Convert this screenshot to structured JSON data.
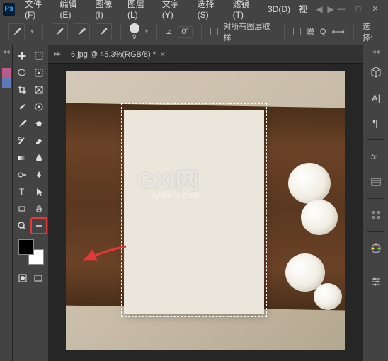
{
  "app": {
    "logo": "Ps"
  },
  "menu": {
    "file": "文件(F)",
    "edit": "编辑(E)",
    "image": "图像(I)",
    "layer": "图层(L)",
    "type": "文字(Y)",
    "select": "选择(S)",
    "filter": "滤镜(T)",
    "threeD": "3D(D)",
    "view": "视"
  },
  "options": {
    "brush_size": "9",
    "angle_icon": "⊿",
    "angle_value": "0°",
    "sample_all": "对所有图层取样",
    "auto_enhance": "增",
    "q_label": "Q",
    "select_label": "选择:"
  },
  "tab": {
    "title": "6.jpg @ 45.3%(RGB/8) *"
  },
  "watermark": {
    "main": "GXI网",
    "sub": "system.com"
  },
  "colors": {
    "fg": "#000000",
    "bg": "#ffffff"
  }
}
